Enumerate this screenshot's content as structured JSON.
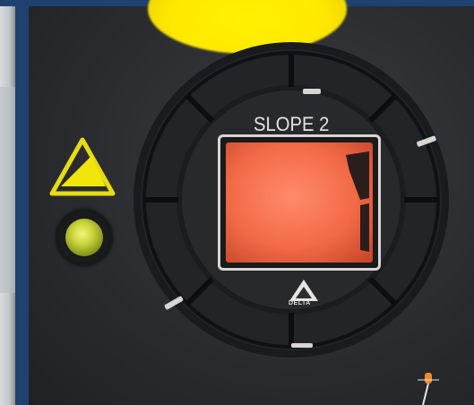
{
  "display": {
    "title": "SLOPE 2",
    "digit": "1",
    "screen_color": "#f26a46"
  },
  "logo": {
    "text": "DELTA"
  },
  "indicators": {
    "warning_icon": "warning-triangle",
    "lamp_color": "#c9d43a",
    "knob_color": "#ffe800"
  }
}
